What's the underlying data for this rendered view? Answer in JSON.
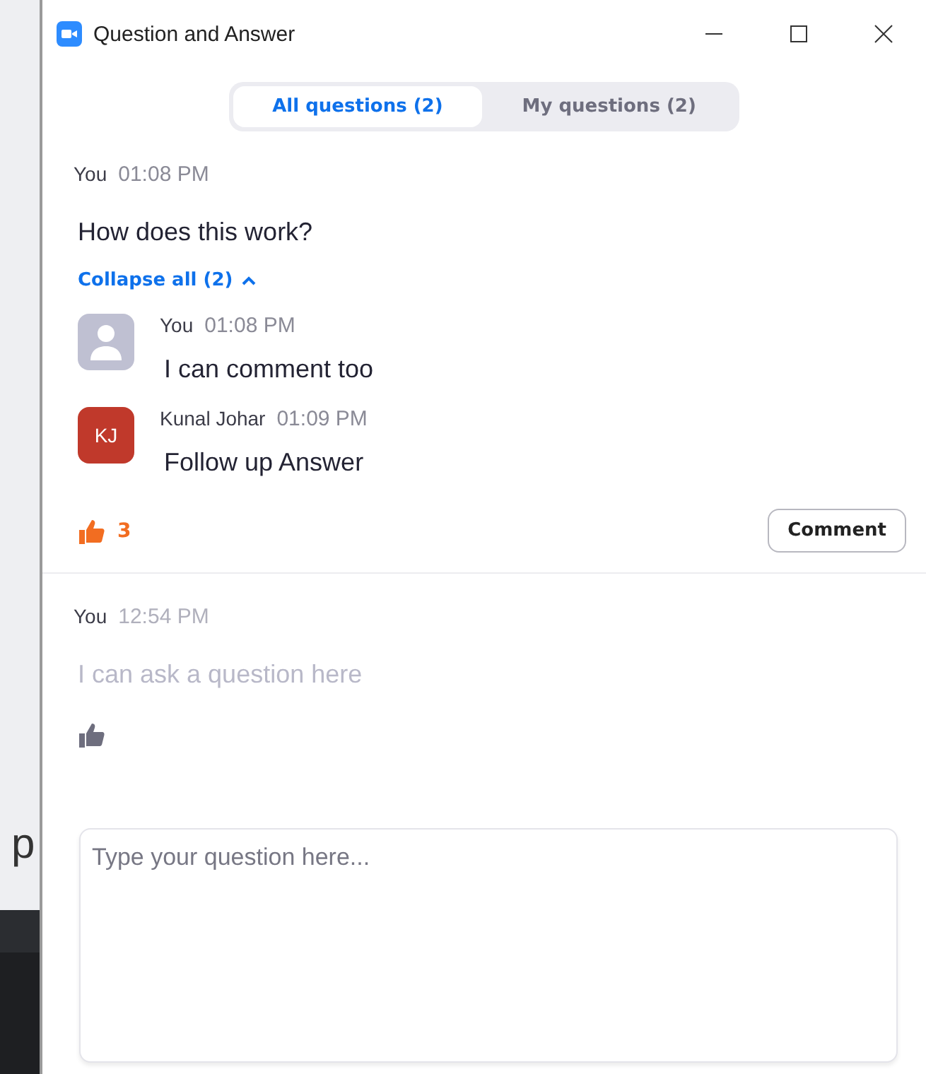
{
  "background": {
    "text": "p"
  },
  "window": {
    "title": "Question and Answer"
  },
  "tabs": [
    {
      "label": "All questions (2)",
      "selected": true
    },
    {
      "label": "My questions (2)",
      "selected": false
    }
  ],
  "questions": [
    {
      "author": "You",
      "time": "01:08 PM",
      "text": "How does this work?",
      "dimmed": false,
      "collapse_label": "Collapse all (2)",
      "expanded": true,
      "replies": [
        {
          "author": "You",
          "time": "01:08 PM",
          "text": "I can comment too",
          "avatar": {
            "kind": "silhouette"
          }
        },
        {
          "author": "Kunal Johar",
          "time": "01:09 PM",
          "text": "Follow up Answer",
          "avatar": {
            "kind": "initials",
            "initials": "KJ",
            "color": "#c0392b"
          }
        }
      ],
      "liked": true,
      "like_count": "3",
      "comment_button": "Comment"
    },
    {
      "author": "You",
      "time": "12:54 PM",
      "text": "I can ask a question here",
      "dimmed": true,
      "liked": false
    }
  ],
  "input": {
    "placeholder": "Type your question here..."
  }
}
